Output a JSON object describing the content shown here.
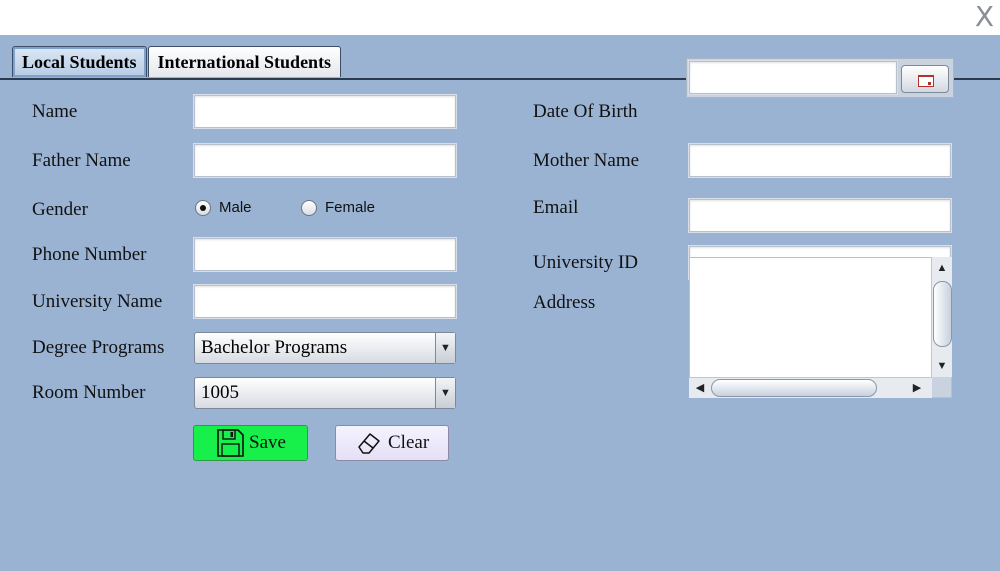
{
  "window": {
    "close_label": "X"
  },
  "tabs": [
    {
      "label": "Local Students",
      "active": true
    },
    {
      "label": "International Students",
      "active": false
    }
  ],
  "left": {
    "name_label": "Name",
    "father_label": "Father Name",
    "gender_label": "Gender",
    "gender_options": [
      "Male",
      "Female"
    ],
    "gender_selected": "Male",
    "phone_label": "Phone Number",
    "university_name_label": "University Name",
    "degree_label": "Degree Programs",
    "degree_value": "Bachelor Programs",
    "room_label": "Room Number",
    "room_value": "1005"
  },
  "right": {
    "dob_label": "Date Of Birth",
    "mother_label": "Mother Name",
    "email_label": "Email",
    "university_id_label": "University ID",
    "address_label": "Address"
  },
  "buttons": {
    "save_label": "Save",
    "clear_label": "Clear"
  },
  "icons": {
    "save": "floppy-disk-icon",
    "clear": "eraser-icon",
    "calendar": "calendar-icon"
  },
  "colors": {
    "panel": "#9ab3d3",
    "save_button": "#17f04a",
    "clear_button": "#e8e5fb"
  }
}
